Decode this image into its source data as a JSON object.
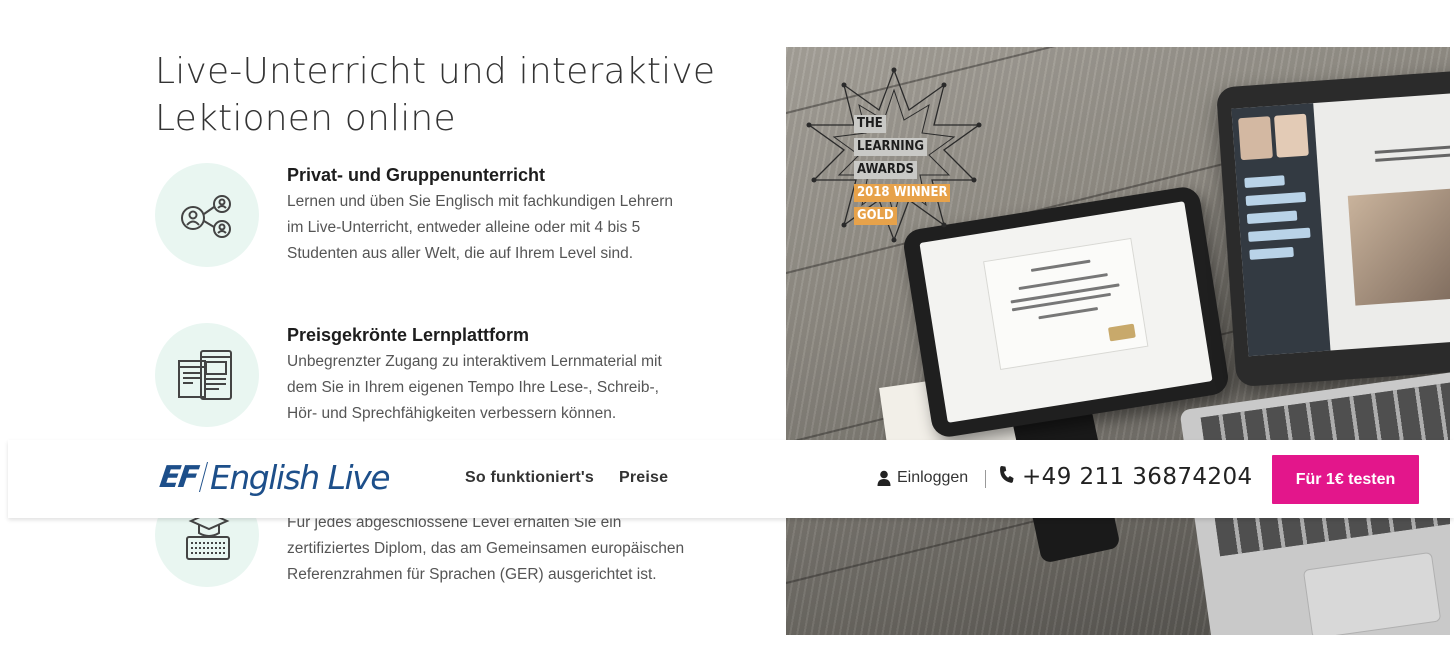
{
  "headline": "Live-Unterricht und interaktive Lektionen online",
  "features": [
    {
      "title": "Privat- und Gruppenunterricht",
      "body": "Lernen und üben Sie Englisch mit fachkundigen Lehrern im Live-Unterricht, entweder alleine oder mit 4 bis 5 Studenten aus aller Welt, die auf Ihrem Level sind.",
      "icon": "users-network-icon"
    },
    {
      "title": "Preisgekrönte Lernplattform",
      "body": "Unbegrenzter Zugang zu interaktivem Lernmaterial mit dem Sie in Ihrem eigenen Tempo Ihre Lese-, Schreib-, Hör- und Sprechfähigkeiten verbessern können.",
      "icon": "devices-icon"
    },
    {
      "title": "",
      "body": "Für jedes abgeschlossene Level erhalten Sie ein zertifiziertes Diplom, das am Gemeinsamen europäischen Referenzrahmen für Sprachen (GER) ausgerichtet ist.",
      "icon": "graduation-keyboard-icon"
    }
  ],
  "award": {
    "line1": "THE",
    "line2": "LEARNING",
    "line3": "AWARDS",
    "line4": "2018 WINNER",
    "line5": "GOLD"
  },
  "nav": {
    "logo_ef": "EF",
    "logo_brand": "English Live",
    "links": [
      "So funktioniert's",
      "Preise"
    ],
    "login": "Einloggen",
    "phone": "+49 211 36874204",
    "cta": "Für 1€ testen"
  },
  "colors": {
    "brand_blue": "#1d4f8a",
    "cta_pink": "#e3168b",
    "icon_circle": "#e9f6f1",
    "award_gold": "#e7a24a"
  }
}
